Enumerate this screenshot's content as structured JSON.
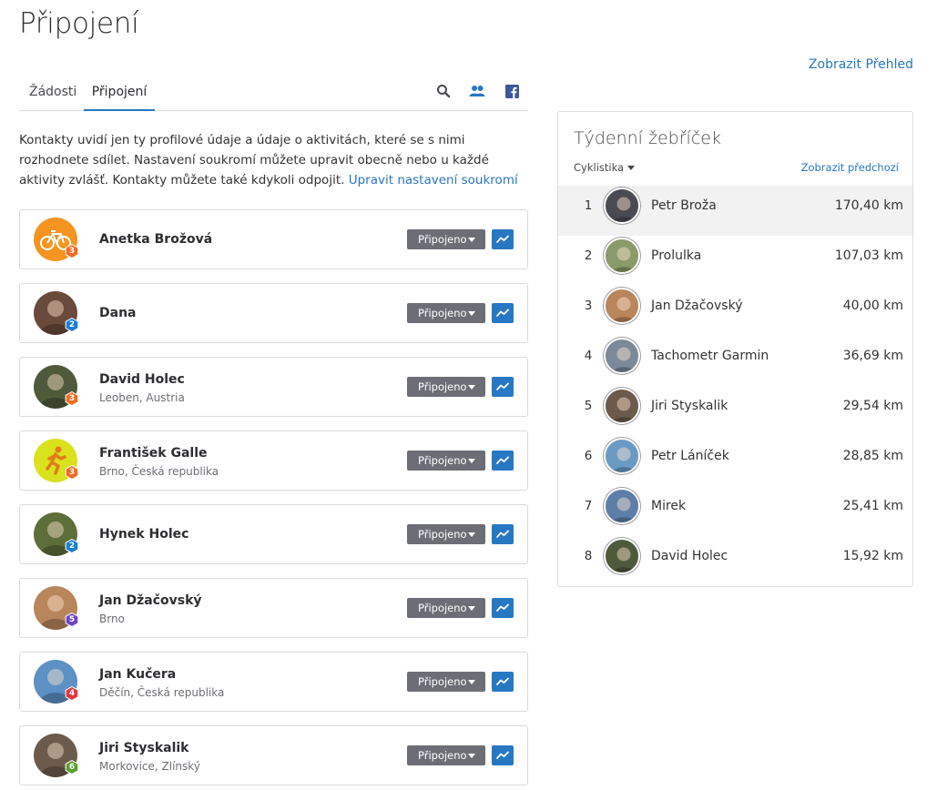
{
  "page": {
    "title": "Připojení",
    "overview_link": "Zobrazit Přehled"
  },
  "tabs": [
    {
      "label": "Žádosti",
      "active": false
    },
    {
      "label": "Připojení",
      "active": true
    }
  ],
  "tab_icons": [
    "search-icon",
    "people-icon",
    "facebook-icon"
  ],
  "intro": {
    "text": "Kontakty uvidí jen ty profilové údaje a údaje o aktivitách, které se s nimi rozhodnete sdílet. Nastavení soukromí můžete upravit obecně nebo u každé aktivity zvlášť. Kontakty můžete také kdykoli odpojit.",
    "link": "Upravit nastavení soukromí"
  },
  "status_label": "Připojeno",
  "athletes": [
    {
      "name": "Anetka Brožová",
      "location": "",
      "badge": "3",
      "badge_color": "#f26b21",
      "avatar_color": "#f5941f",
      "avatar_icon": "bicycle-icon"
    },
    {
      "name": "Dana",
      "location": "",
      "badge": "2",
      "badge_color": "#1a7fd1",
      "avatar_color": "#6a4a3a",
      "avatar_icon": ""
    },
    {
      "name": "David Holec",
      "location": "Leoben, Austria",
      "badge": "3",
      "badge_color": "#f26b21",
      "avatar_color": "#4f5a3a",
      "avatar_icon": ""
    },
    {
      "name": "František Galle",
      "location": "Brno, Česká republika",
      "badge": "3",
      "badge_color": "#f26b21",
      "avatar_color": "#d9e21c",
      "avatar_icon": "runner-icon"
    },
    {
      "name": "Hynek Holec",
      "location": "",
      "badge": "2",
      "badge_color": "#1a7fd1",
      "avatar_color": "#5e6e3a",
      "avatar_icon": ""
    },
    {
      "name": "Jan Džačovský",
      "location": "Brno",
      "badge": "5",
      "badge_color": "#6b44c9",
      "avatar_color": "#b9855b",
      "avatar_icon": ""
    },
    {
      "name": "Jan Kučera",
      "location": "Děčín, Česká republika",
      "badge": "4",
      "badge_color": "#e0363c",
      "avatar_color": "#5d90c4",
      "avatar_icon": ""
    },
    {
      "name": "Jiri Styskalik",
      "location": "Morkovice, Zlínský",
      "badge": "6",
      "badge_color": "#5aa02c",
      "avatar_color": "#6c5a4a",
      "avatar_icon": ""
    }
  ],
  "leaderboard": {
    "title": "Týdenní žebříček",
    "sport": "Cyklistika",
    "prev_link": "Zobrazit předchozí",
    "rows": [
      {
        "rank": "1",
        "name": "Petr Broža",
        "distance": "170,40 km",
        "avatar_color": "#4a4a52",
        "highlight": true
      },
      {
        "rank": "2",
        "name": "Prolulka",
        "distance": "107,03 km",
        "avatar_color": "#8a9a6a",
        "highlight": false
      },
      {
        "rank": "3",
        "name": "Jan Džačovský",
        "distance": "40,00 km",
        "avatar_color": "#b9855b",
        "highlight": false
      },
      {
        "rank": "4",
        "name": "Tachometr Garmin",
        "distance": "36,69 km",
        "avatar_color": "#7a8a9a",
        "highlight": false
      },
      {
        "rank": "5",
        "name": "Jiri Styskalik",
        "distance": "29,54 km",
        "avatar_color": "#6c5a4a",
        "highlight": false
      },
      {
        "rank": "6",
        "name": "Petr Láníček",
        "distance": "28,85 km",
        "avatar_color": "#6a9ac4",
        "highlight": false
      },
      {
        "rank": "7",
        "name": "Mirek",
        "distance": "25,41 km",
        "avatar_color": "#5d7ea8",
        "highlight": false
      },
      {
        "rank": "8",
        "name": "David Holec",
        "distance": "15,92 km",
        "avatar_color": "#4f5a3a",
        "highlight": false
      }
    ]
  }
}
